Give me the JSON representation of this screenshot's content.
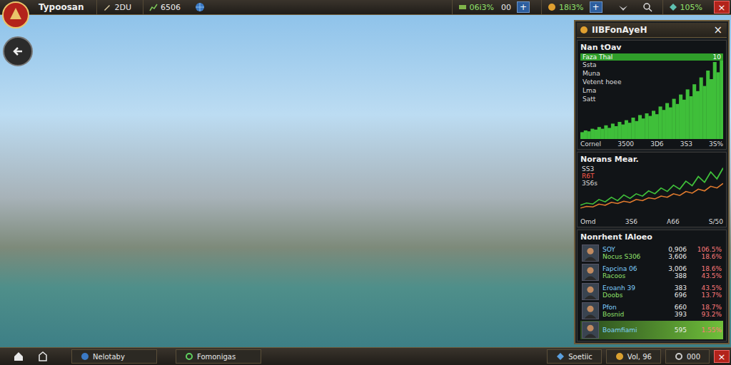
{
  "top_bar": {
    "title": "Typoosan",
    "left_stats": [
      {
        "value": "2DU"
      },
      {
        "value": "6506"
      }
    ],
    "right_stats": [
      {
        "value": "06i3%",
        "extra": "00",
        "plus": "+"
      },
      {
        "value": "18i3%",
        "extra": "",
        "plus": "+"
      }
    ],
    "zoom": "105%",
    "close": "×"
  },
  "panel": {
    "title": "IIBFonAyeH",
    "close": "×",
    "chart1": {
      "title": "Nan tOav",
      "highlight_label": "Faza Thal",
      "highlight_value": "10",
      "labels": [
        "Ssta",
        "Muna",
        "Vetent hoee",
        "Lma",
        "Satt"
      ],
      "values": [
        8,
        10,
        9,
        12,
        11,
        14,
        12,
        16,
        13,
        18,
        15,
        20,
        17,
        22,
        19,
        25,
        21,
        28,
        24,
        30,
        27,
        33,
        29,
        38,
        34,
        42,
        37,
        47,
        41,
        52,
        46,
        58,
        50,
        64,
        56,
        72,
        62,
        80,
        70,
        90,
        78,
        95
      ],
      "footer": [
        "Cornel",
        "3500",
        "3D6",
        "3S3",
        "3S%"
      ]
    },
    "chart2": {
      "title": "Norans Mear.",
      "labels": [
        "SS3",
        "R6T",
        "3S6s"
      ],
      "green": [
        20,
        24,
        22,
        30,
        26,
        34,
        28,
        38,
        32,
        40,
        36,
        45,
        40,
        50,
        44,
        55,
        48,
        62,
        54,
        70,
        60,
        78,
        66,
        85
      ],
      "orange": [
        15,
        18,
        17,
        22,
        20,
        25,
        23,
        27,
        25,
        30,
        28,
        33,
        31,
        36,
        34,
        40,
        37,
        44,
        41,
        48,
        45,
        53,
        50,
        58
      ],
      "footer": [
        "Omd",
        "3S6",
        "A66",
        "S/50"
      ]
    },
    "list": {
      "title": "Nonrhent lAloeo",
      "rows": [
        {
          "name": "SOY",
          "sub": "Nocus S306",
          "value": "0,906",
          "sub_value": "3,606",
          "pct": "106.5%",
          "sub_pct": "18.6%",
          "selected": false
        },
        {
          "name": "Fapcina 06",
          "sub": "Racoos",
          "value": "3,006",
          "sub_value": "388",
          "pct": "18.6%",
          "sub_pct": "43.5%",
          "selected": false
        },
        {
          "name": "Eroanh 39",
          "sub": "Doobs",
          "value": "383",
          "sub_value": "696",
          "pct": "43.5%",
          "sub_pct": "13.7%",
          "selected": false
        },
        {
          "name": "Pfon",
          "sub": "Bosnid",
          "value": "660",
          "sub_value": "393",
          "pct": "18.7%",
          "sub_pct": "93.2%",
          "selected": false
        },
        {
          "name": "Boamfiami",
          "sub": "",
          "value": "595",
          "sub_value": "",
          "pct": "1.55%",
          "sub_pct": "",
          "selected": true
        }
      ]
    }
  },
  "bottom_bar": {
    "buttons": [
      "Nelotaby",
      "Fomonigas"
    ],
    "right_items": [
      "Soetiic",
      "Vol, 96",
      "000"
    ],
    "close": "×"
  }
}
